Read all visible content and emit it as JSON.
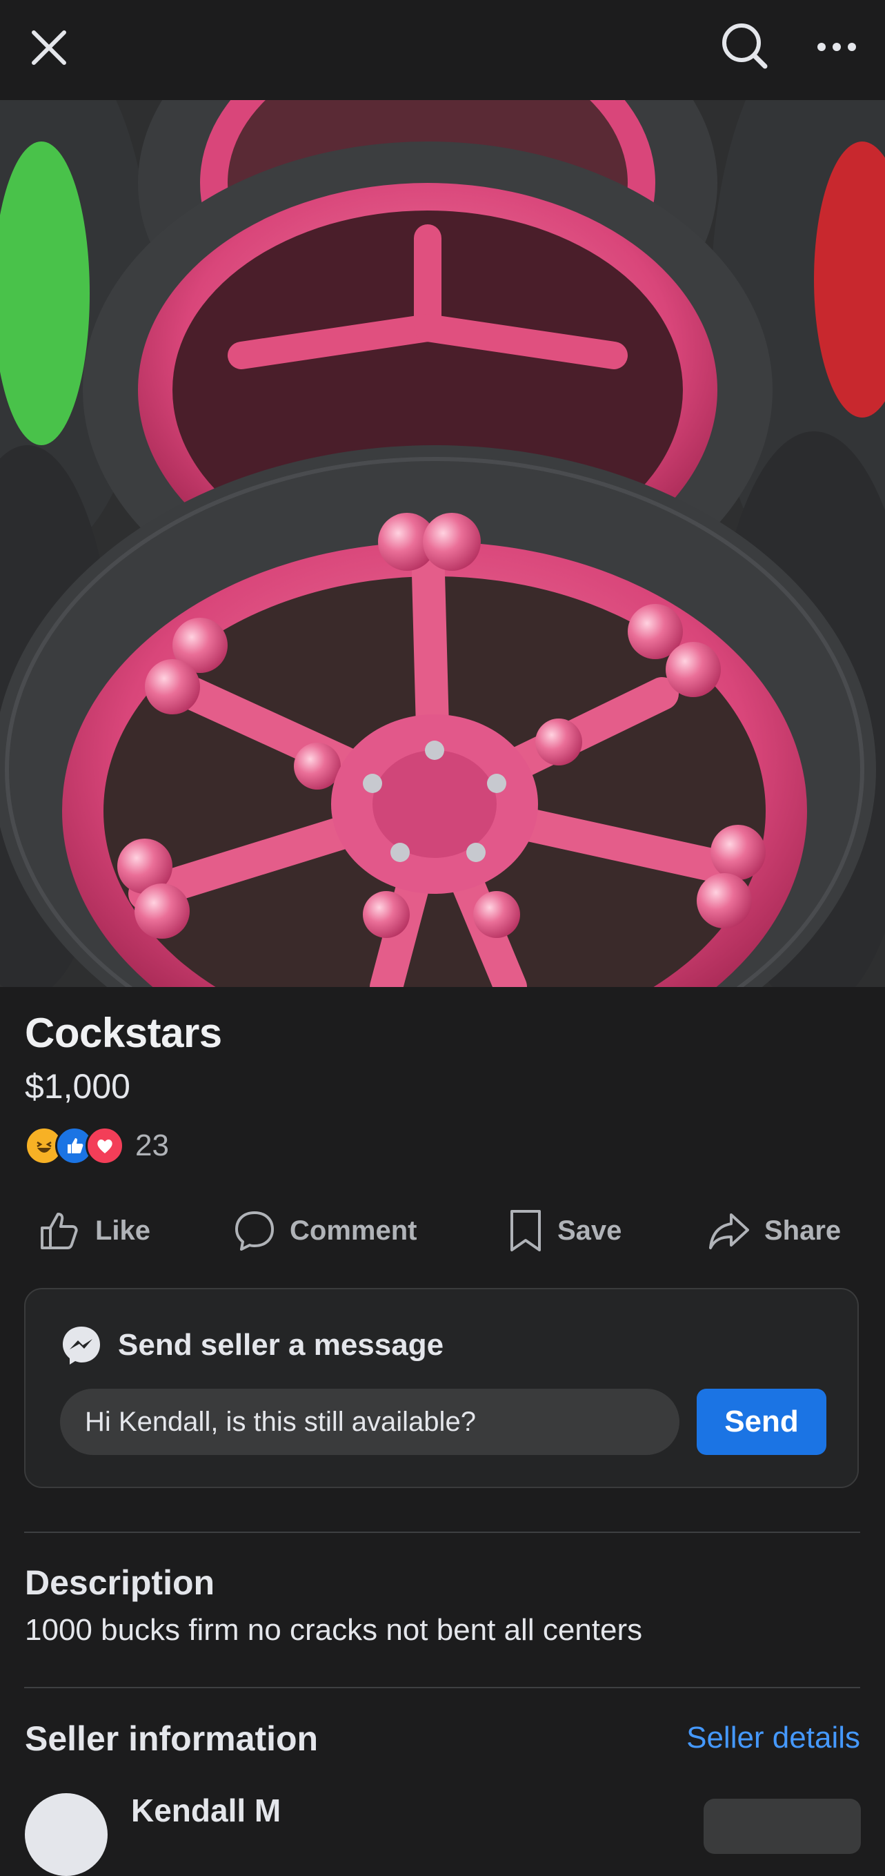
{
  "header": {
    "close_icon": "close-icon",
    "search_icon": "search-icon",
    "more_icon": "more-options-icon"
  },
  "listing": {
    "title": "Cockstars",
    "price": "$1,000",
    "reaction_icons": [
      "haha-emoji",
      "like-thumb",
      "love-heart"
    ],
    "reaction_count": "23"
  },
  "actions": {
    "like": "Like",
    "comment": "Comment",
    "save": "Save",
    "share": "Share"
  },
  "message": {
    "title": "Send seller a message",
    "input_value": "Hi Kendall, is this still available?",
    "send_label": "Send"
  },
  "description": {
    "heading": "Description",
    "text": "1000 bucks firm no cracks not bent all centers"
  },
  "seller": {
    "heading": "Seller information",
    "details_link": "Seller details",
    "name": "Kendall M"
  },
  "colors": {
    "background": "#1c1c1d",
    "card": "#242526",
    "accent": "#1b74e4",
    "link": "#4599ff",
    "wheel_pink": "#e0507f"
  }
}
